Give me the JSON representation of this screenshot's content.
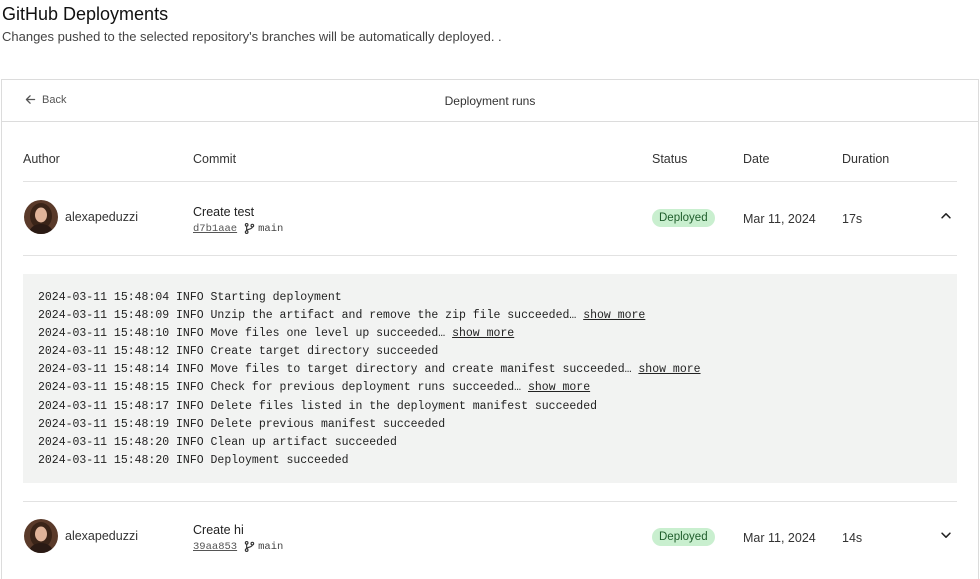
{
  "page": {
    "title": "GitHub Deployments",
    "subtitle": "Changes pushed to the selected repository's branches will be automatically deployed. ."
  },
  "panel": {
    "back_label": "Back",
    "title": "Deployment runs"
  },
  "columns": {
    "author": "Author",
    "commit": "Commit",
    "status": "Status",
    "date": "Date",
    "duration": "Duration"
  },
  "runs": [
    {
      "author": "alexapeduzzi",
      "commit_message": "Create test",
      "sha": "d7b1aae",
      "branch": "main",
      "status": "Deployed",
      "date": "Mar 11, 2024",
      "duration": "17s",
      "expanded": true
    },
    {
      "author": "alexapeduzzi",
      "commit_message": "Create hi",
      "sha": "39aa853",
      "branch": "main",
      "status": "Deployed",
      "date": "Mar 11, 2024",
      "duration": "14s",
      "expanded": false
    }
  ],
  "log": {
    "show_more_label": "show more",
    "lines": [
      {
        "text": "2024-03-11 15:48:04 INFO Starting deployment",
        "more": false
      },
      {
        "text": "2024-03-11 15:48:09 INFO Unzip the artifact and remove the zip file succeeded…",
        "more": true
      },
      {
        "text": "2024-03-11 15:48:10 INFO Move files one level up succeeded…",
        "more": true
      },
      {
        "text": "2024-03-11 15:48:12 INFO Create target directory succeeded",
        "more": false
      },
      {
        "text": "2024-03-11 15:48:14 INFO Move files to target directory and create manifest succeeded…",
        "more": true
      },
      {
        "text": "2024-03-11 15:48:15 INFO Check for previous deployment runs succeeded…",
        "more": true
      },
      {
        "text": "2024-03-11 15:48:17 INFO Delete files listed in the deployment manifest succeeded",
        "more": false
      },
      {
        "text": "2024-03-11 15:48:19 INFO Delete previous manifest succeeded",
        "more": false
      },
      {
        "text": "2024-03-11 15:48:20 INFO Clean up artifact succeeded",
        "more": false
      },
      {
        "text": "2024-03-11 15:48:20 INFO Deployment succeeded",
        "more": false
      }
    ]
  },
  "colors": {
    "badge_bg": "#c9efcf",
    "badge_text": "#1e5d2b",
    "log_bg": "#f2f3f2",
    "border": "#dcdcdc"
  },
  "icons": {
    "back": "arrow-left-icon",
    "branch": "git-branch-icon",
    "collapse": "chevron-up-icon",
    "expand": "chevron-down-icon"
  }
}
